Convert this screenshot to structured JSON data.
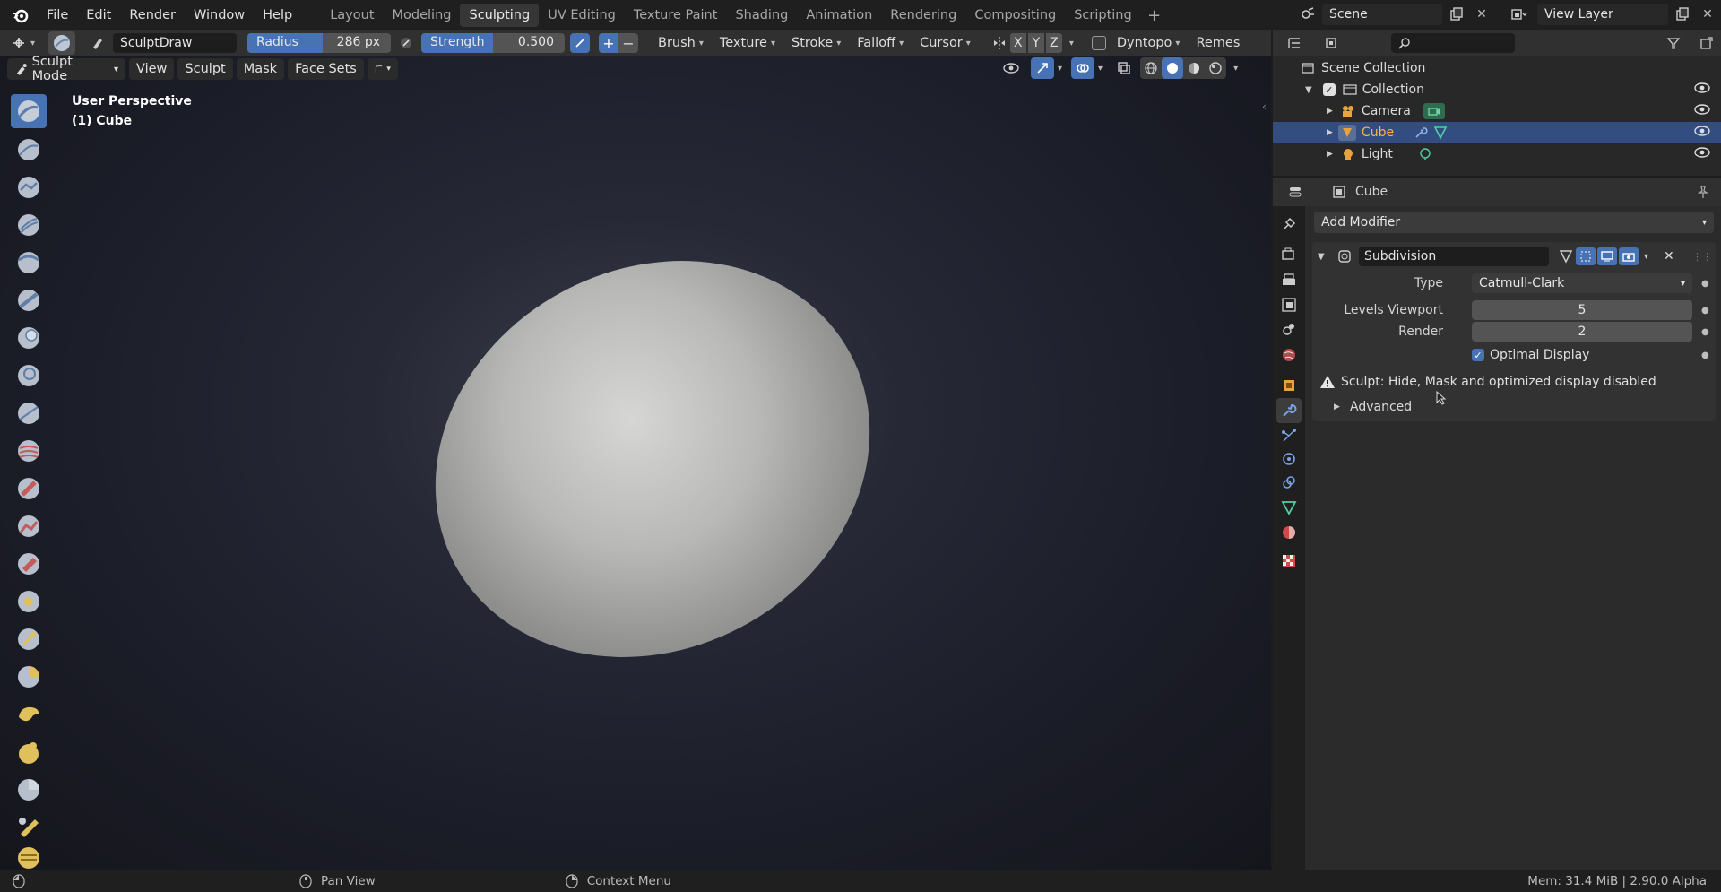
{
  "menubar": {
    "items": [
      "File",
      "Edit",
      "Render",
      "Window",
      "Help"
    ]
  },
  "workspaces": {
    "tabs": [
      "Layout",
      "Modeling",
      "Sculpting",
      "UV Editing",
      "Texture Paint",
      "Shading",
      "Animation",
      "Rendering",
      "Compositing",
      "Scripting"
    ],
    "active": "Sculpting"
  },
  "scene": {
    "name": "Scene",
    "view_layer": "View Layer"
  },
  "toolheader": {
    "brush_name": "SculptDraw",
    "radius_label": "Radius",
    "radius_value": "286 px",
    "strength_label": "Strength",
    "strength_value": "0.500",
    "plus": "+",
    "minus": "−",
    "dropdowns": [
      "Brush",
      "Texture",
      "Stroke",
      "Falloff",
      "Cursor"
    ],
    "axes": [
      "X",
      "Y",
      "Z"
    ],
    "dyntopo": "Dyntopo",
    "remesh": "Remes"
  },
  "moderow": {
    "mode": "Sculpt Mode",
    "menus": [
      "View",
      "Sculpt",
      "Mask",
      "Face Sets"
    ]
  },
  "viewport": {
    "perspective": "User Perspective",
    "object": "(1) Cube"
  },
  "outliner": {
    "root": "Scene Collection",
    "collection": "Collection",
    "items": [
      {
        "name": "Camera",
        "selected": false
      },
      {
        "name": "Cube",
        "selected": true
      },
      {
        "name": "Light",
        "selected": false
      }
    ]
  },
  "properties": {
    "object_name": "Cube",
    "add_modifier": "Add Modifier",
    "modifier_name": "Subdivision",
    "type_label": "Type",
    "type_value": "Catmull-Clark",
    "levels_viewport_label": "Levels Viewport",
    "levels_viewport_value": "5",
    "render_label": "Render",
    "render_value": "2",
    "optimal_display": "Optimal Display",
    "warning": "Sculpt: Hide, Mask and optimized display disabled",
    "advanced": "Advanced"
  },
  "statusbar": {
    "left_action": "Pan View",
    "mid_action": "Context Menu",
    "right_info": "Mem: 31.4 MiB | 2.90.0 Alpha"
  },
  "colors": {
    "accent_blue": "#4772b3",
    "selection": "#334d80",
    "cube_orange": "#e8a33c"
  }
}
